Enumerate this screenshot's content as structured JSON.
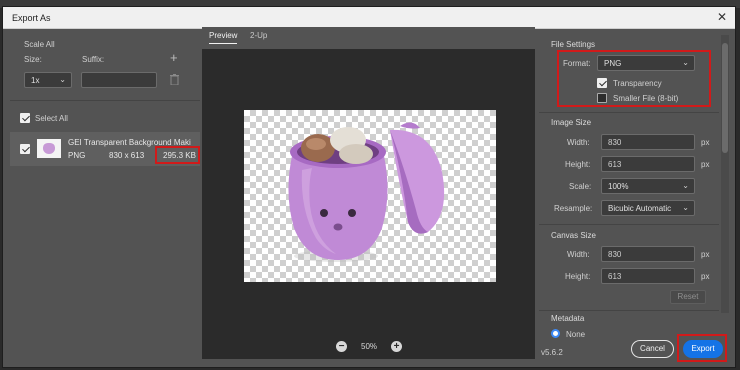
{
  "dialog": {
    "title": "Export As",
    "close_glyph": "✕"
  },
  "scale_panel": {
    "heading": "Scale All",
    "size_label": "Size:",
    "suffix_label": "Suffix:",
    "size_value": "1x",
    "suffix_value": "",
    "add_icon": "+",
    "delete_icon": "trash-icon",
    "select_all_label": "Select All",
    "select_all_checked": true
  },
  "file_item": {
    "name": "GEI Transparent Background Maki",
    "format": "PNG",
    "dimensions": "830 x 613",
    "size": "295.3 KB",
    "checked": true
  },
  "preview": {
    "tabs": [
      {
        "label": "Preview",
        "active": true
      },
      {
        "label": "2-Up",
        "active": false
      }
    ],
    "zoom": "50%",
    "zoom_out_icon": "−",
    "zoom_in_icon": "+"
  },
  "file_settings": {
    "heading": "File Settings",
    "format_label": "Format:",
    "format_value": "PNG",
    "transparency_label": "Transparency",
    "transparency_checked": true,
    "smaller_file_label": "Smaller File (8-bit)",
    "smaller_file_checked": false
  },
  "image_size": {
    "heading": "Image Size",
    "width_label": "Width:",
    "width_value": "830",
    "height_label": "Height:",
    "height_value": "613",
    "unit": "px",
    "scale_label": "Scale:",
    "scale_value": "100%",
    "resample_label": "Resample:",
    "resample_value": "Bicubic Automatic"
  },
  "canvas_size": {
    "heading": "Canvas Size",
    "width_label": "Width:",
    "width_value": "830",
    "height_label": "Height:",
    "height_value": "613",
    "unit": "px",
    "reset_label": "Reset"
  },
  "metadata": {
    "heading": "Metadata",
    "option_label": "None"
  },
  "footer": {
    "version": "v5.6.2",
    "cancel_label": "Cancel",
    "export_label": "Export"
  },
  "colors": {
    "highlight_red": "#d11a1a",
    "accent_blue": "#1473e6"
  }
}
